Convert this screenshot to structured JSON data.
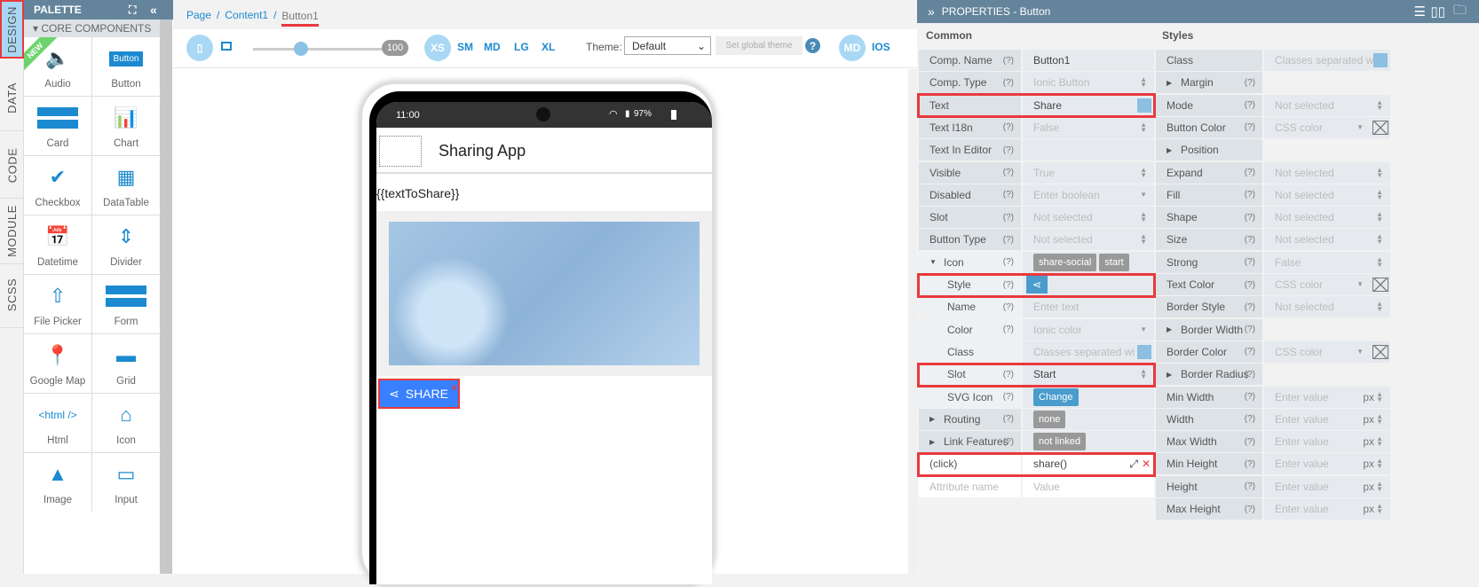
{
  "side_tabs": [
    "DESIGN",
    "DATA",
    "CODE",
    "MODULE",
    "SCSS"
  ],
  "palette": {
    "title": "PALETTE",
    "section": "CORE COMPONENTS",
    "new_badge": "NEW",
    "items": [
      "Audio",
      "Button",
      "Card",
      "Chart",
      "Checkbox",
      "DataTable",
      "Datetime",
      "Divider",
      "File Picker",
      "Form",
      "Google Map",
      "Grid",
      "Html",
      "Icon",
      "Image",
      "Input"
    ],
    "button_icon_label": "Button",
    "html_icon_label": "<html />"
  },
  "breadcrumb": [
    "Page",
    "Content1",
    "Button1"
  ],
  "toolbar": {
    "zoom": "100",
    "zoom_fraction": 0.4,
    "breakpoints": [
      "XS",
      "SM",
      "MD",
      "LG",
      "XL"
    ],
    "theme_label": "Theme:",
    "theme_value": "Default",
    "set_theme": "Set global theme",
    "help": "?",
    "md": "MD",
    "ios": "IOS"
  },
  "phone": {
    "time": "11:00",
    "battery": "97%",
    "title": "Sharing App",
    "text": "{{textToShare}}",
    "button": "SHARE"
  },
  "properties": {
    "title": "PROPERTIES - Button",
    "common": "Common",
    "styles": "Styles",
    "common_rows": [
      {
        "label": "Comp. Name",
        "q": "(?)",
        "value": "Button1",
        "dark": true
      },
      {
        "label": "Comp. Type",
        "q": "(?)",
        "value": "Ionic Button",
        "spin": true
      },
      {
        "label": "Text",
        "q": "",
        "value": "Share",
        "dark": true,
        "expand": true
      },
      {
        "label": "Text I18n",
        "q": "(?)",
        "value": "False",
        "spin": true
      },
      {
        "label": "Text In Editor",
        "q": "(?)",
        "value": ""
      },
      {
        "label": "Visible",
        "q": "(?)",
        "value": "True",
        "spin": true
      },
      {
        "label": "Disabled",
        "q": "(?)",
        "value": "Enter boolean",
        "drop": true
      },
      {
        "label": "Slot",
        "q": "(?)",
        "value": "Not selected",
        "spin": true
      },
      {
        "label": "Button Type",
        "q": "(?)",
        "value": "Not selected",
        "spin": true
      },
      {
        "label": "Icon",
        "q": "(?)",
        "caret": "open",
        "chips": [
          "share-social",
          "start"
        ]
      },
      {
        "label": "Style",
        "q": "(?)",
        "indent": true,
        "shareicon": true
      },
      {
        "label": "Name",
        "q": "(?)",
        "indent": true,
        "value": "Enter text"
      },
      {
        "label": "Color",
        "q": "(?)",
        "indent": true,
        "value": "Ionic color",
        "drop": true
      },
      {
        "label": "Class",
        "q": "",
        "indent": true,
        "value": "Classes separated wi",
        "expand": true
      },
      {
        "label": "Slot",
        "q": "(?)",
        "indent": true,
        "value": "Start",
        "dark": true,
        "spin": true
      },
      {
        "label": "SVG Icon",
        "q": "(?)",
        "indent": true,
        "bluechip": "Change"
      },
      {
        "label": "Routing",
        "q": "(?)",
        "caret": "closed",
        "chips": [
          "none"
        ]
      },
      {
        "label": "Link Features",
        "q": "(?)",
        "caret": "closed",
        "chips": [
          "not linked"
        ]
      },
      {
        "label": "(click)",
        "q": "",
        "value": "share()",
        "dark": true,
        "white": true,
        "actions": true
      },
      {
        "label": "Attribute name",
        "q": "",
        "value": "Value",
        "white": true,
        "placeholder": true
      }
    ],
    "style_rows": [
      {
        "label": "Class",
        "q": "",
        "value": "Classes separated w",
        "expand": true
      },
      {
        "label": "Margin",
        "q": "(?)",
        "caret": "closed"
      },
      {
        "label": "Mode",
        "q": "(?)",
        "value": "Not selected",
        "spin": true
      },
      {
        "label": "Button Color",
        "q": "(?)",
        "value": "CSS color",
        "color": true
      },
      {
        "label": "Position",
        "q": "",
        "caret": "closed"
      },
      {
        "label": "Expand",
        "q": "(?)",
        "value": "Not selected",
        "spin": true
      },
      {
        "label": "Fill",
        "q": "(?)",
        "value": "Not selected",
        "spin": true
      },
      {
        "label": "Shape",
        "q": "(?)",
        "value": "Not selected",
        "spin": true
      },
      {
        "label": "Size",
        "q": "(?)",
        "value": "Not selected",
        "spin": true
      },
      {
        "label": "Strong",
        "q": "(?)",
        "value": "False",
        "spin": true
      },
      {
        "label": "Text Color",
        "q": "(?)",
        "value": "CSS color",
        "color": true
      },
      {
        "label": "Border Style",
        "q": "(?)",
        "value": "Not selected",
        "spin": true
      },
      {
        "label": "Border Width",
        "q": "(?)",
        "caret": "closed"
      },
      {
        "label": "Border Color",
        "q": "(?)",
        "value": "CSS color",
        "color": true
      },
      {
        "label": "Border Radius",
        "q": "(?)",
        "caret": "closed"
      },
      {
        "label": "Min Width",
        "q": "(?)",
        "value": "Enter value",
        "px": "px"
      },
      {
        "label": "Width",
        "q": "(?)",
        "value": "Enter value",
        "px": "px"
      },
      {
        "label": "Max Width",
        "q": "(?)",
        "value": "Enter value",
        "px": "px"
      },
      {
        "label": "Min Height",
        "q": "(?)",
        "value": "Enter value",
        "px": "px"
      },
      {
        "label": "Height",
        "q": "(?)",
        "value": "Enter value",
        "px": "px"
      },
      {
        "label": "Max Height",
        "q": "(?)",
        "value": "Enter value",
        "px": "px"
      }
    ]
  },
  "colors": {
    "accent": "#1c8ad0",
    "header": "#64849c",
    "highlight": "#e9393d",
    "button": "#3880ff"
  }
}
